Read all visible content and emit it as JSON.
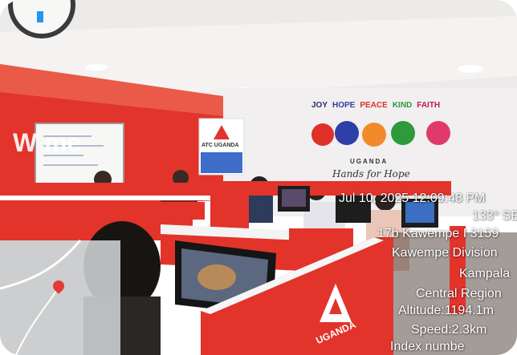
{
  "wall": {
    "welcome_sign": "W      me",
    "slogan_words": [
      {
        "text": "JOY",
        "color": "#2a2a6e"
      },
      {
        "text": "HOPE",
        "color": "#2f3fa8"
      },
      {
        "text": "PEACE",
        "color": "#e0302a"
      },
      {
        "text": "KIND",
        "color": "#2e9a3a"
      },
      {
        "text": "FAITH",
        "color": "#c2185b"
      }
    ],
    "country": "UGANDA",
    "program": "Hands for Hope"
  },
  "banner": {
    "brand": "ATC UGANDA"
  },
  "cubicle": {
    "brand": "UGANDA"
  },
  "overlay": {
    "datetime": "Jul 10, 2025 12:09:48 PM",
    "heading": "133° SE",
    "address": "17b Kawempe I 3159",
    "division": "Kawempe Division",
    "city": "Kampala",
    "region": "Central Region",
    "altitude": "Altitude:1194.1m",
    "speed": "Speed:2.3km",
    "index": "Index numbe"
  },
  "colors": {
    "brand_red": "#e2342b",
    "wall": "#f1eff0",
    "ceiling": "#ecebe9"
  },
  "icons": {
    "compass": "compass-icon",
    "map_pin": "map-pin-icon"
  }
}
